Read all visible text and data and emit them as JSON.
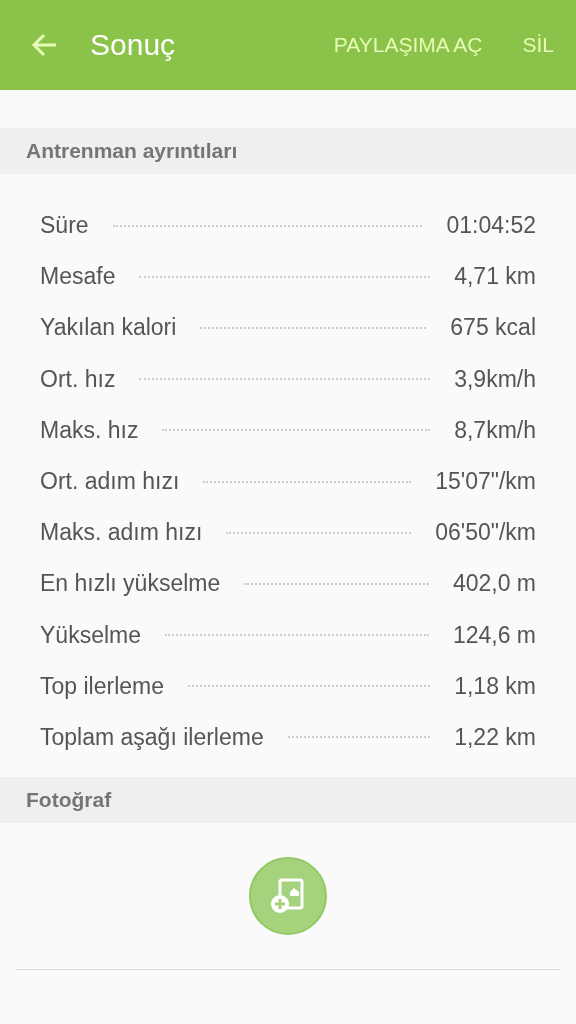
{
  "app_bar": {
    "title": "Sonuç",
    "actions": [
      "PAYLAŞIMA AÇ",
      "SİL"
    ]
  },
  "details": {
    "title": "Antrenman ayrıntıları",
    "rows": [
      {
        "label": "Süre",
        "value": "01:04:52"
      },
      {
        "label": "Mesafe",
        "value": "4,71 km"
      },
      {
        "label": "Yakılan kalori",
        "value": "675 kcal"
      },
      {
        "label": "Ort. hız",
        "value": "3,9km/h"
      },
      {
        "label": "Maks. hız",
        "value": "8,7km/h"
      },
      {
        "label": "Ort. adım hızı",
        "value": "15'07\"/km"
      },
      {
        "label": "Maks. adım hızı",
        "value": "06'50\"/km"
      },
      {
        "label": "En hızlı yükselme",
        "value": "402,0 m"
      },
      {
        "label": "Yükselme",
        "value": "124,6 m"
      },
      {
        "label": "Top ilerleme",
        "value": "1,18 km"
      },
      {
        "label": "Toplam aşağı ilerleme",
        "value": "1,22 km"
      }
    ]
  },
  "photo": {
    "title": "Fotoğraf"
  }
}
